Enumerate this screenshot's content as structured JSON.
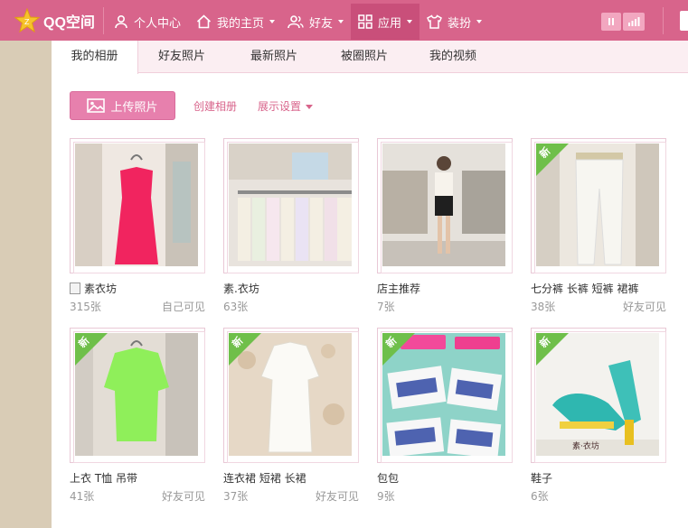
{
  "topbar": {
    "logo_text": "QQ空间",
    "nav": [
      {
        "label": "个人中心",
        "icon": "person-icon"
      },
      {
        "label": "我的主页",
        "icon": "home-icon"
      },
      {
        "label": "好友",
        "icon": "friends-icon"
      },
      {
        "label": "应用",
        "icon": "apps-icon"
      },
      {
        "label": "装扮",
        "icon": "tshirt-icon"
      }
    ],
    "colors": {
      "bar": "#d8648b",
      "active": "#c94f7a"
    }
  },
  "tabs": [
    "我的相册",
    "好友照片",
    "最新照片",
    "被圈照片",
    "我的视频"
  ],
  "toolbar": {
    "upload_label": "上传照片",
    "create_album": "创建相册",
    "display_settings": "展示设置"
  },
  "albums": [
    {
      "name": "素衣坊",
      "count": "315张",
      "permission": "自己可见",
      "is_new": false,
      "has_book_icon": true
    },
    {
      "name": "素.衣坊",
      "count": "63张",
      "permission": "",
      "is_new": false
    },
    {
      "name": "店主推荐",
      "count": "7张",
      "permission": "",
      "is_new": false
    },
    {
      "name": "七分裤 长裤 短裤 裙裤",
      "count": "38张",
      "permission": "好友可见",
      "is_new": true
    },
    {
      "name": "上衣 T恤 吊带",
      "count": "41张",
      "permission": "好友可见",
      "is_new": true
    },
    {
      "name": "连衣裙 短裙 长裙",
      "count": "37张",
      "permission": "好友可见",
      "is_new": true
    },
    {
      "name": "包包",
      "count": "9张",
      "permission": "",
      "is_new": true
    },
    {
      "name": "鞋子",
      "count": "6张",
      "permission": "",
      "is_new": true
    }
  ],
  "new_flag_label": "新",
  "accent_color": "#d8648b"
}
